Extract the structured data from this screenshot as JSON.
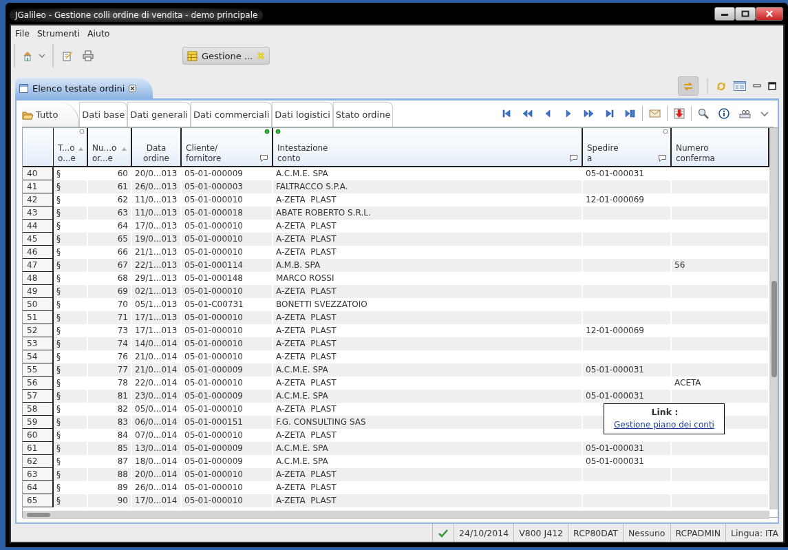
{
  "window": {
    "title": "JGalileo - Gestione colli ordine di vendita - demo principale"
  },
  "menu": [
    "File",
    "Strumenti",
    "Aiuto"
  ],
  "editor_tabs": [
    {
      "label": "Gestione ...",
      "selected": true
    }
  ],
  "view_tab": {
    "label": "Elenco testate ordini"
  },
  "subtabs": [
    {
      "label": "Tutto",
      "selected": true
    },
    {
      "label": "Dati base",
      "selected": false
    },
    {
      "label": "Dati generali",
      "selected": false
    },
    {
      "label": "Dati commerciali",
      "selected": false
    },
    {
      "label": "Dati logistici",
      "selected": false
    },
    {
      "label": "Stato ordine",
      "selected": false
    }
  ],
  "table": {
    "columns": [
      {
        "label": "T...o\no...e",
        "sorted": true,
        "note": false,
        "circle": true,
        "green_dot": false
      },
      {
        "label": "Nu...o\nor...e",
        "sorted": true,
        "note": false,
        "circle": false,
        "green_dot": false
      },
      {
        "label": "Data\nordine",
        "sorted": false,
        "note": false,
        "circle": false,
        "green_dot": false
      },
      {
        "label": "Cliente/\nfornitore",
        "sorted": false,
        "note": true,
        "circle": false,
        "green_dot": true
      },
      {
        "label": "Intestazione\nconto",
        "sorted": false,
        "note": true,
        "circle": false,
        "green_dot": true
      },
      {
        "label": "Spedire\na",
        "sorted": false,
        "note": true,
        "circle": true,
        "green_dot": false
      },
      {
        "label": "Numero\nconferma",
        "sorted": false,
        "note": false,
        "circle": false,
        "green_dot": false
      }
    ],
    "rows": [
      {
        "number": "40",
        "type": "§",
        "order": "60",
        "date": "20/0...013",
        "customer": "05-01-000009",
        "name": "A.C.M.E. SPA",
        "ship_to": "05-01-000031"
      },
      {
        "number": "41",
        "type": "§",
        "order": "61",
        "date": "26/0...013",
        "customer": "05-01-000003",
        "name": "FALTRACCO S.P.A."
      },
      {
        "number": "42",
        "type": "§",
        "order": "62",
        "date": "11/0...013",
        "customer": "05-01-000010",
        "name": "A-ZETA  PLAST",
        "ship_to": "12-01-000069"
      },
      {
        "number": "43",
        "type": "§",
        "order": "63",
        "date": "11/0...013",
        "customer": "05-01-000018",
        "name": "ABATE ROBERTO S.R.L."
      },
      {
        "number": "44",
        "type": "§",
        "order": "64",
        "date": "17/0...013",
        "customer": "05-01-000010",
        "name": "A-ZETA  PLAST"
      },
      {
        "number": "45",
        "type": "§",
        "order": "65",
        "date": "19/0...013",
        "customer": "05-01-000010",
        "name": "A-ZETA  PLAST"
      },
      {
        "number": "46",
        "type": "§",
        "order": "66",
        "date": "21/1...013",
        "customer": "05-01-000010",
        "name": "A-ZETA  PLAST"
      },
      {
        "number": "47",
        "type": "§",
        "order": "67",
        "date": "22/1...013",
        "customer": "05-01-000114",
        "name": "A.M.B. SPA",
        "confirmation": "56"
      },
      {
        "number": "48",
        "type": "§",
        "order": "68",
        "date": "29/1...013",
        "customer": "05-01-000148",
        "name": "MARCO ROSSI"
      },
      {
        "number": "49",
        "type": "§",
        "order": "69",
        "date": "02/1...013",
        "customer": "05-01-000010",
        "name": "A-ZETA  PLAST"
      },
      {
        "number": "50",
        "type": "§",
        "order": "70",
        "date": "05/1...013",
        "customer": "05-01-C00731",
        "name": "BONETTI SVEZZATOIO"
      },
      {
        "number": "51",
        "type": "§",
        "order": "71",
        "date": "17/1...013",
        "customer": "05-01-000010",
        "name": "A-ZETA  PLAST"
      },
      {
        "number": "52",
        "type": "§",
        "order": "73",
        "date": "17/1...013",
        "customer": "05-01-000010",
        "name": "A-ZETA  PLAST",
        "ship_to": "12-01-000069"
      },
      {
        "number": "53",
        "type": "§",
        "order": "74",
        "date": "14/0...014",
        "customer": "05-01-000010",
        "name": "A-ZETA  PLAST"
      },
      {
        "number": "54",
        "type": "§",
        "order": "76",
        "date": "21/0...014",
        "customer": "05-01-000010",
        "name": "A-ZETA  PLAST"
      },
      {
        "number": "55",
        "type": "§",
        "order": "77",
        "date": "21/0...014",
        "customer": "05-01-000009",
        "name": "A.C.M.E. SPA",
        "ship_to": "05-01-000031"
      },
      {
        "number": "56",
        "type": "§",
        "order": "78",
        "date": "22/0...014",
        "customer": "05-01-000010",
        "name": "A-ZETA  PLAST",
        "confirmation": "ACETA"
      },
      {
        "number": "57",
        "type": "§",
        "order": "81",
        "date": "23/0...014",
        "customer": "05-01-000009",
        "name": "A.C.M.E. SPA",
        "ship_to": "05-01-000031"
      },
      {
        "number": "58",
        "type": "§",
        "order": "82",
        "date": "05/0...014",
        "customer": "05-01-000010",
        "name": "A-ZETA  PLAST"
      },
      {
        "number": "59",
        "type": "§",
        "order": "83",
        "date": "06/0...014",
        "customer": "05-01-000151",
        "name": "F.G. CONSULTING SAS"
      },
      {
        "number": "60",
        "type": "§",
        "order": "84",
        "date": "07/0...014",
        "customer": "05-01-000010",
        "name": "A-ZETA  PLAST"
      },
      {
        "number": "61",
        "type": "§",
        "order": "85",
        "date": "13/0...014",
        "customer": "05-01-000009",
        "name": "A.C.M.E. SPA",
        "ship_to": "05-01-000031"
      },
      {
        "number": "62",
        "type": "§",
        "order": "87",
        "date": "18/0...014",
        "customer": "05-01-000009",
        "name": "A.C.M.E. SPA",
        "ship_to": "05-01-000031"
      },
      {
        "number": "63",
        "type": "§",
        "order": "88",
        "date": "20/0...014",
        "customer": "05-01-000010",
        "name": "A-ZETA  PLAST"
      },
      {
        "number": "64",
        "type": "§",
        "order": "89",
        "date": "26/0...014",
        "customer": "05-01-000010",
        "name": "A-ZETA  PLAST"
      },
      {
        "number": "65",
        "type": "§",
        "order": "90",
        "date": "17/0...014",
        "customer": "05-01-000010",
        "name": "A-ZETA  PLAST"
      }
    ]
  },
  "tooltip": {
    "title": "Link :",
    "link": "Gestione piano dei conti"
  },
  "status_bar": [
    "24/10/2014",
    "V800 J412",
    "RCP80DAT",
    "Nessuno",
    "RCPADMIN",
    "Lingua: ITA"
  ]
}
